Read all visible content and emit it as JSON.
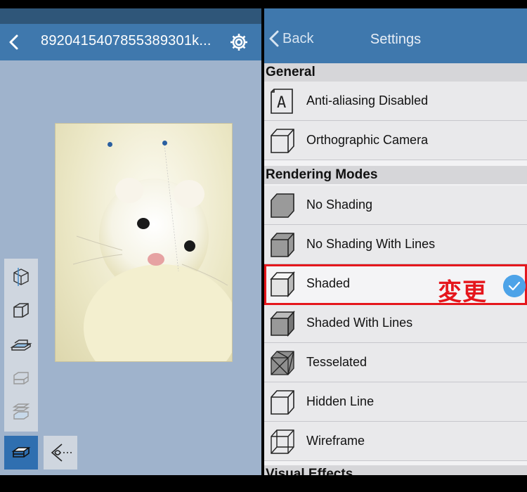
{
  "left": {
    "title": "8920415407855389301k...",
    "icons": {
      "back": "chevron-left-icon",
      "settings": "gear-icon"
    },
    "toolbar": [
      "cube-clip-icon",
      "cube-box-icon",
      "section-plane-icon",
      "layers-icon",
      "stacked-layers-icon",
      "layer-active-icon",
      "eye-icon"
    ],
    "colors": {
      "navbar": "#3f78ad",
      "canvas": "#9fb3cc",
      "active_tool": "#2f6fb0"
    }
  },
  "right": {
    "back_label": "Back",
    "title": "Settings",
    "sections": {
      "general": "General",
      "rendering": "Rendering Modes",
      "visual_cut": "Visual Effects"
    },
    "items": {
      "antialias": "Anti-aliasing Disabled",
      "ortho": "Orthographic Camera",
      "no_shading": "No Shading",
      "no_shading_lines": "No Shading With Lines",
      "shaded": "Shaded",
      "shaded_lines": "Shaded With Lines",
      "tesselated": "Tesselated",
      "hidden_line": "Hidden Line",
      "wireframe": "Wireframe"
    },
    "selected_item": "Shaded",
    "annotation": "変更",
    "colors": {
      "highlight": "#e5161c",
      "check": "#4da3e8"
    }
  }
}
